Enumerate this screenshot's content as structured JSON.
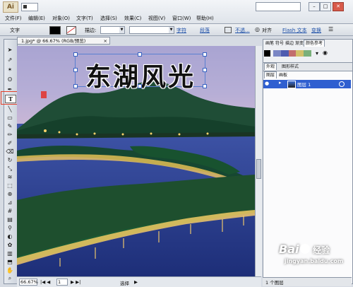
{
  "app": {
    "logo": "Ai"
  },
  "menu": [
    "文件(F)",
    "编辑(E)",
    "对象(O)",
    "文字(T)",
    "选择(S)",
    "效果(C)",
    "视图(V)",
    "窗口(W)",
    "帮助(H)"
  ],
  "window_buttons": [
    "–",
    "□",
    "✕"
  ],
  "control_bar": {
    "tool_label": "文字",
    "stroke_label": "描边:",
    "char_link": "字符",
    "para_link": "段落",
    "opacity_link": "不透...",
    "align_label": "对齐",
    "flash_link": "Flash 文本",
    "transform_link": "变换"
  },
  "document": {
    "tab_title": "1.jpg* @ 66.67% (RGB/预览)",
    "close": "×",
    "headline": "东湖风光"
  },
  "status": {
    "zoom": "66.67%",
    "page": "1",
    "mode": "选择"
  },
  "panels": {
    "top_tabs": [
      "画笔",
      "符号",
      "描边",
      "渐变",
      "颜色参考"
    ],
    "mid_tabs": [
      "外观",
      "图形样式"
    ],
    "layers_tabs": [
      "图层",
      "画板"
    ],
    "layer_name": "图层 1",
    "layers_count": "1 个图层",
    "swatches": [
      "#7a86c4",
      "#4d5bb0",
      "#c26d6d",
      "#d2c06a",
      "#7ab07a"
    ]
  },
  "watermark": {
    "brand": "Bai",
    "suffix": "经验",
    "url": "jingyan.baidu.com"
  },
  "colors": {
    "accent": "#2f5fd0",
    "highlight": "#e4412c"
  }
}
